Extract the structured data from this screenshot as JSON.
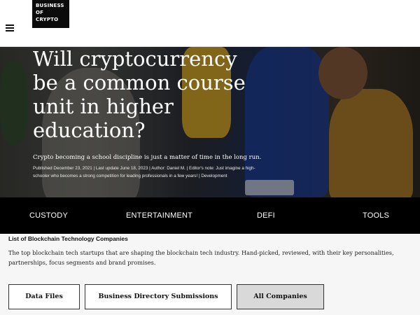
{
  "header": {
    "logo_line1": "BUSINESS",
    "logo_line2": "OF CRYPTO",
    "menu_icon": "hamburger-icon"
  },
  "hero": {
    "title": "Will cryptocurrency be a common course unit in higher education?",
    "subtitle": "Crypto becoming a school discipline is just a matter of time in the long run.",
    "meta": "Published December 23, 2021 | Last update June 18, 2023 | Author: Daniel M. | Editor's note: Just imagine a high-schooler who becomes a strong competition for leading professionals in a few years! | Development"
  },
  "categories": [
    "CUSTODY",
    "ENTERTAINMENT",
    "DEFI",
    "TOOLS"
  ],
  "list_section": {
    "title": "List of Blockchain Technology Companies",
    "description": "The top blockchain tech startups that are shaping the blockchain tech industry. Hand-picked, reviewed, with their key personalities, partnerships, focus segments and brand promises.",
    "buttons": [
      "Data Files",
      "Business Directory Submissions",
      "All Companies"
    ]
  },
  "colors": {
    "header_bg": "#ffffff",
    "category_bar_bg": "#000000",
    "selected_button_bg": "#d9d9d9"
  }
}
